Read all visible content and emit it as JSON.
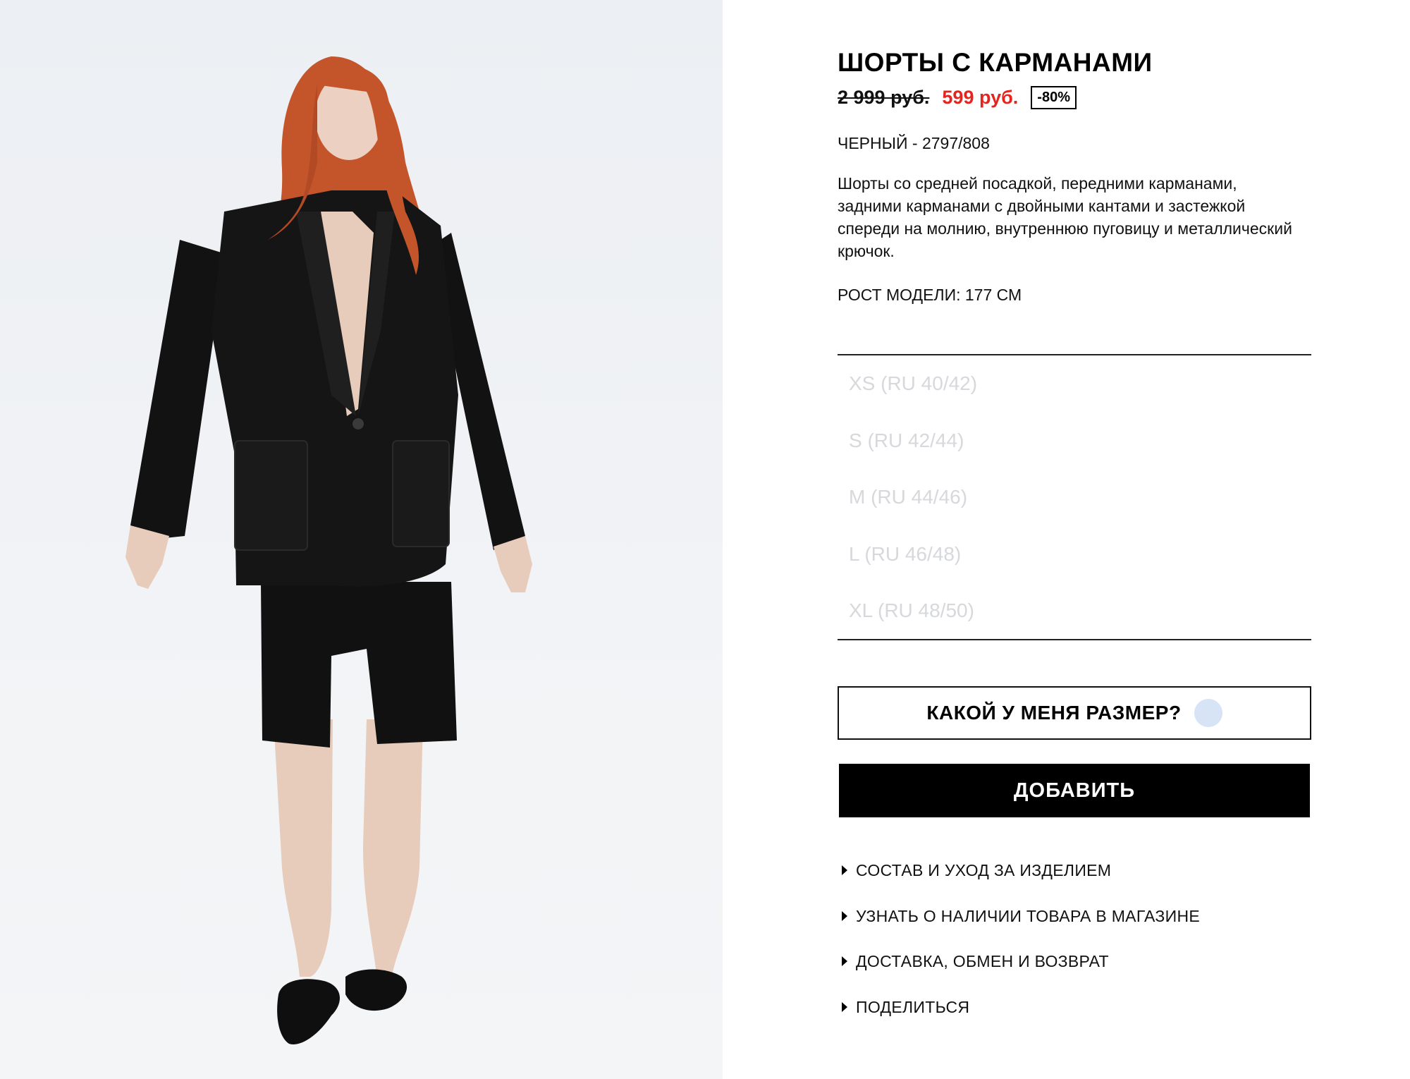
{
  "product": {
    "title": "ШОРТЫ С КАРМАНАМИ",
    "old_price": "2 999 руб.",
    "new_price": "599 руб.",
    "discount": "-80%",
    "color_ref": "ЧЕРНЫЙ - 2797/808",
    "description": "Шорты со средней посадкой, передними карманами, задними карманами с двойными кантами и застежкой спереди на молнию, внутреннюю пуговицу и металлический крючок.",
    "model_height": "РОСТ МОДЕЛИ: 177 СМ"
  },
  "sizes": [
    {
      "label": "XS (RU 40/42)"
    },
    {
      "label": "S (RU 42/44)"
    },
    {
      "label": "M (RU 44/46)"
    },
    {
      "label": "L (RU 46/48)"
    },
    {
      "label": "XL (RU 48/50)"
    }
  ],
  "actions": {
    "size_help_label": "КАКОЙ У МЕНЯ РАЗМЕР?",
    "add_label": "ДОБАВИТЬ"
  },
  "links": [
    {
      "label": "СОСТАВ И УХОД ЗА ИЗДЕЛИЕМ"
    },
    {
      "label": "УЗНАТЬ О НАЛИЧИИ ТОВАРА В МАГАЗИНЕ"
    },
    {
      "label": "ДОСТАВКА, ОБМЕН И ВОЗВРАТ"
    },
    {
      "label": "ПОДЕЛИТЬСЯ"
    }
  ],
  "colors": {
    "sale_price": "#e4241f",
    "size_unavailable": "#d6d8dc",
    "primary_button": "#000000",
    "size_help_dot": "#d6e4f6"
  }
}
